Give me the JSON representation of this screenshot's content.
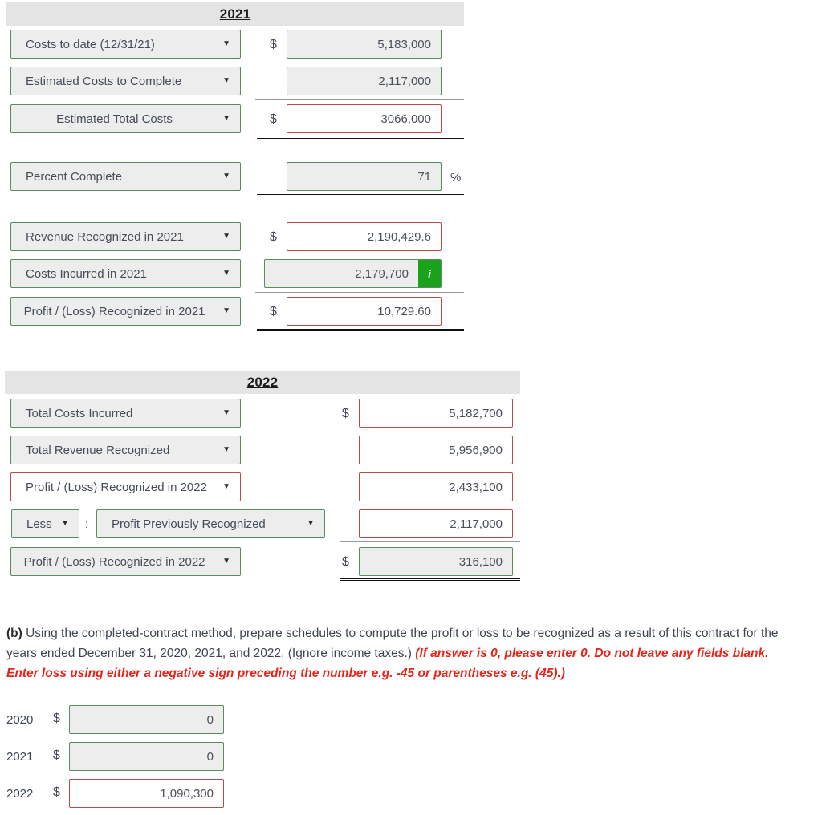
{
  "colors": {
    "green_border": "#5a8a5e",
    "red_border": "#b94a48",
    "info_green": "#1aa31a",
    "header_gray": "#e4e4e4",
    "field_gray": "#ededed",
    "red_note": "#e8241a"
  },
  "caret": "▼",
  "symbols": {
    "dollar": "$",
    "percent": "%",
    "colon": ":",
    "info": "i"
  },
  "section_2021": {
    "title": "2021",
    "rows": [
      {
        "label": "Costs to date (12/31/21)",
        "dollar": "$",
        "value": "5,183,000",
        "state": "readonly"
      },
      {
        "label": "Estimated Costs to Complete",
        "dollar": "",
        "value": "2,117,000",
        "state": "readonly"
      },
      {
        "label": "Estimated Total Costs",
        "dollar": "$",
        "value": "3066,000",
        "state": "error"
      }
    ],
    "percent_row": {
      "label": "Percent Complete",
      "value": "71",
      "unit": "%",
      "state": "readonly"
    },
    "profit_rows": [
      {
        "label": "Revenue Recognized in 2021",
        "dollar": "$",
        "value": "2,190,429.6",
        "state": "error"
      },
      {
        "label": "Costs Incurred in 2021",
        "dollar": "",
        "value": "2,179,700",
        "state": "readonly",
        "info": "i"
      },
      {
        "label": "Profit / (Loss) Recognized in 2021",
        "dollar": "$",
        "value": "10,729.60",
        "state": "error"
      }
    ]
  },
  "section_2022": {
    "title": "2022",
    "rows": [
      {
        "label": "Total Costs Incurred",
        "dollar": "$",
        "value": "5,182,700",
        "select_state": "ok",
        "input_state": "error"
      },
      {
        "label": "Total Revenue Recognized",
        "dollar": "",
        "value": "5,956,900",
        "select_state": "ok",
        "input_state": "error"
      },
      {
        "label": "Profit / (Loss) Recognized in 2022",
        "dollar": "",
        "value": "2,433,100",
        "select_state": "error",
        "input_state": "error"
      }
    ],
    "less_row": {
      "operator": "Less",
      "colon": ":",
      "label": "Profit Previously Recognized",
      "value": "2,117,000",
      "input_state": "error"
    },
    "total_row": {
      "label": "Profit / (Loss) Recognized in 2022",
      "dollar": "$",
      "value": "316,100",
      "select_state": "ok",
      "input_state": "readonly"
    }
  },
  "question_b": {
    "marker": "(b)",
    "body": " Using the completed-contract method, prepare schedules to compute the profit or loss to be recognized as a result of this contract for the years ended December 31, 2020, 2021, and 2022. (Ignore income taxes.) ",
    "note": "(If answer is 0, please enter 0. Do not leave any fields blank. Enter loss using either a negative sign preceding the number e.g. -45 or parentheses e.g. (45).)"
  },
  "answer_rows": [
    {
      "year": "2020",
      "dollar": "$",
      "value": "0",
      "state": "readonly"
    },
    {
      "year": "2021",
      "dollar": "$",
      "value": "0",
      "state": "readonly"
    },
    {
      "year": "2022",
      "dollar": "$",
      "value": "1,090,300",
      "state": "error"
    }
  ]
}
